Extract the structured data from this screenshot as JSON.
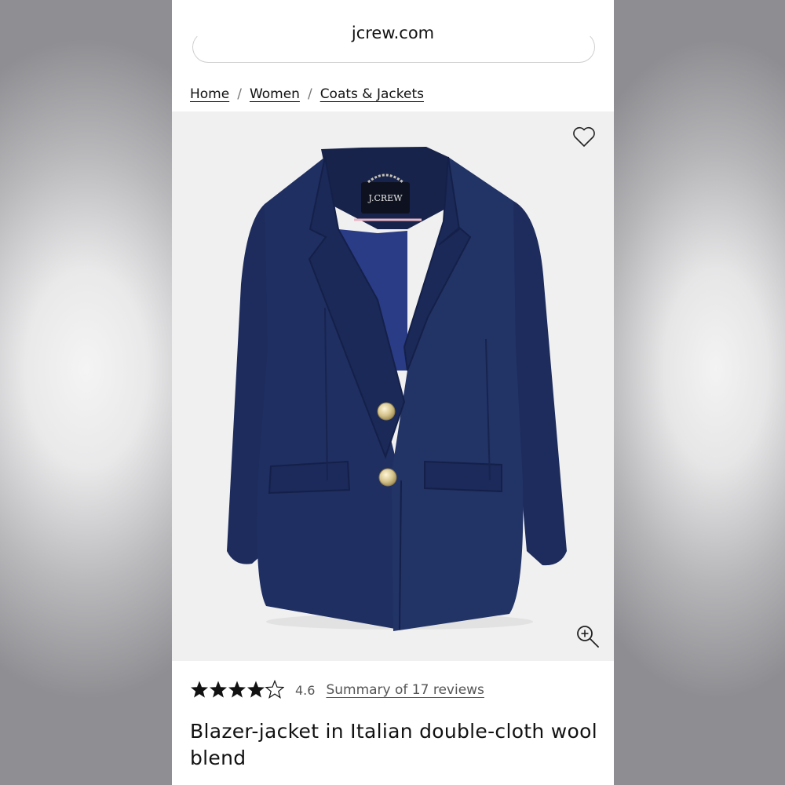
{
  "browser": {
    "url": "jcrew.com"
  },
  "breadcrumb": [
    {
      "label": "Home"
    },
    {
      "label": "Women"
    },
    {
      "label": "Coats & Jackets"
    }
  ],
  "breadcrumb_separator": "/",
  "product": {
    "image_logo_text": "J.CREW",
    "rating_value": "4.6",
    "rating_stars": 4.6,
    "reviews_link": "Summary of 17 reviews",
    "title": "Blazer-jacket in Italian double-cloth wool blend",
    "garment_color": "#1e2d5e"
  },
  "icons": {
    "wishlist": "heart-icon",
    "zoom": "zoom-in-icon",
    "rating": "star-icon"
  }
}
